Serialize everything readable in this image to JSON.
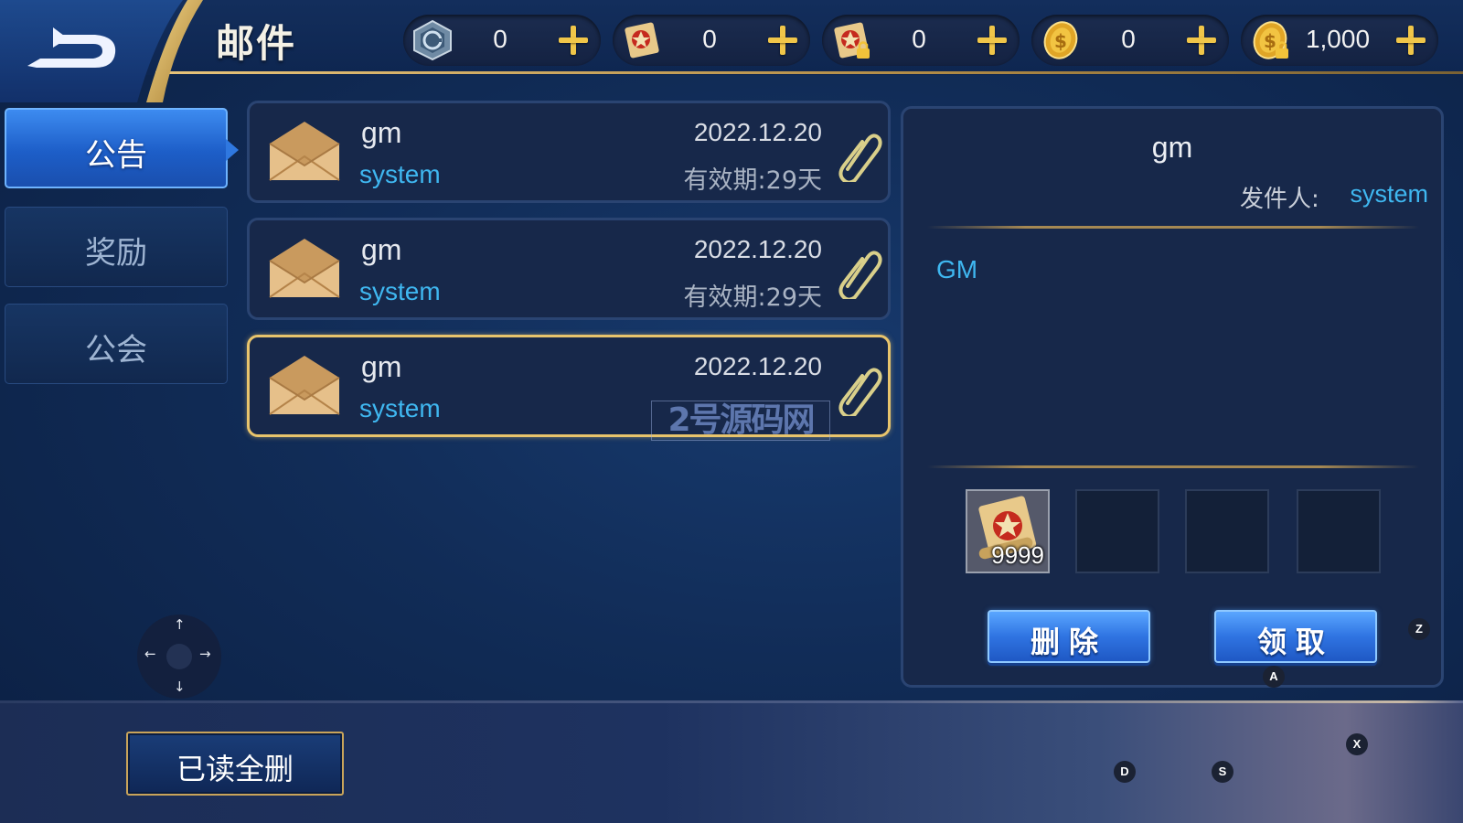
{
  "header": {
    "back_icon": "back-arrow-icon",
    "title": "邮件",
    "currencies": [
      {
        "icon": "hex-coin-icon",
        "value": "0"
      },
      {
        "icon": "scroll-icon",
        "value": "0"
      },
      {
        "icon": "locked-scroll-icon",
        "value": "0"
      },
      {
        "icon": "gold-coin-icon",
        "value": "0"
      },
      {
        "icon": "locked-gold-coin-icon",
        "value": "1,000"
      }
    ]
  },
  "tabs": [
    {
      "label": "公告",
      "active": true
    },
    {
      "label": "奖励",
      "active": false
    },
    {
      "label": "公会",
      "active": false
    }
  ],
  "mails": [
    {
      "title": "gm",
      "sender": "system",
      "date": "2022.12.20",
      "expire": "有效期:29天",
      "selected": false
    },
    {
      "title": "gm",
      "sender": "system",
      "date": "2022.12.20",
      "expire": "有效期:29天",
      "selected": false
    },
    {
      "title": "gm",
      "sender": "system",
      "date": "2022.12.20",
      "expire": "",
      "selected": true
    }
  ],
  "watermark": "2号源码网",
  "detail": {
    "title": "gm",
    "sender_label": "发件人:",
    "sender": "system",
    "body": "GM",
    "attachments": [
      {
        "icon": "scroll-icon",
        "count": "9999"
      },
      {
        "icon": "",
        "count": ""
      },
      {
        "icon": "",
        "count": ""
      },
      {
        "icon": "",
        "count": ""
      }
    ],
    "delete_label": "删除",
    "claim_label": "领取"
  },
  "footer": {
    "delete_all_label": "已读全删"
  },
  "key_hints": {
    "z": "Z",
    "a": "A",
    "x": "X",
    "d": "D",
    "s": "S",
    "up": "↑",
    "down": "↓",
    "left": "←",
    "right": "→"
  },
  "colors": {
    "accent_blue": "#3fb7f0",
    "gold": "#e8c46c",
    "active_tab": "#2f78e0",
    "background": "#112c57"
  }
}
